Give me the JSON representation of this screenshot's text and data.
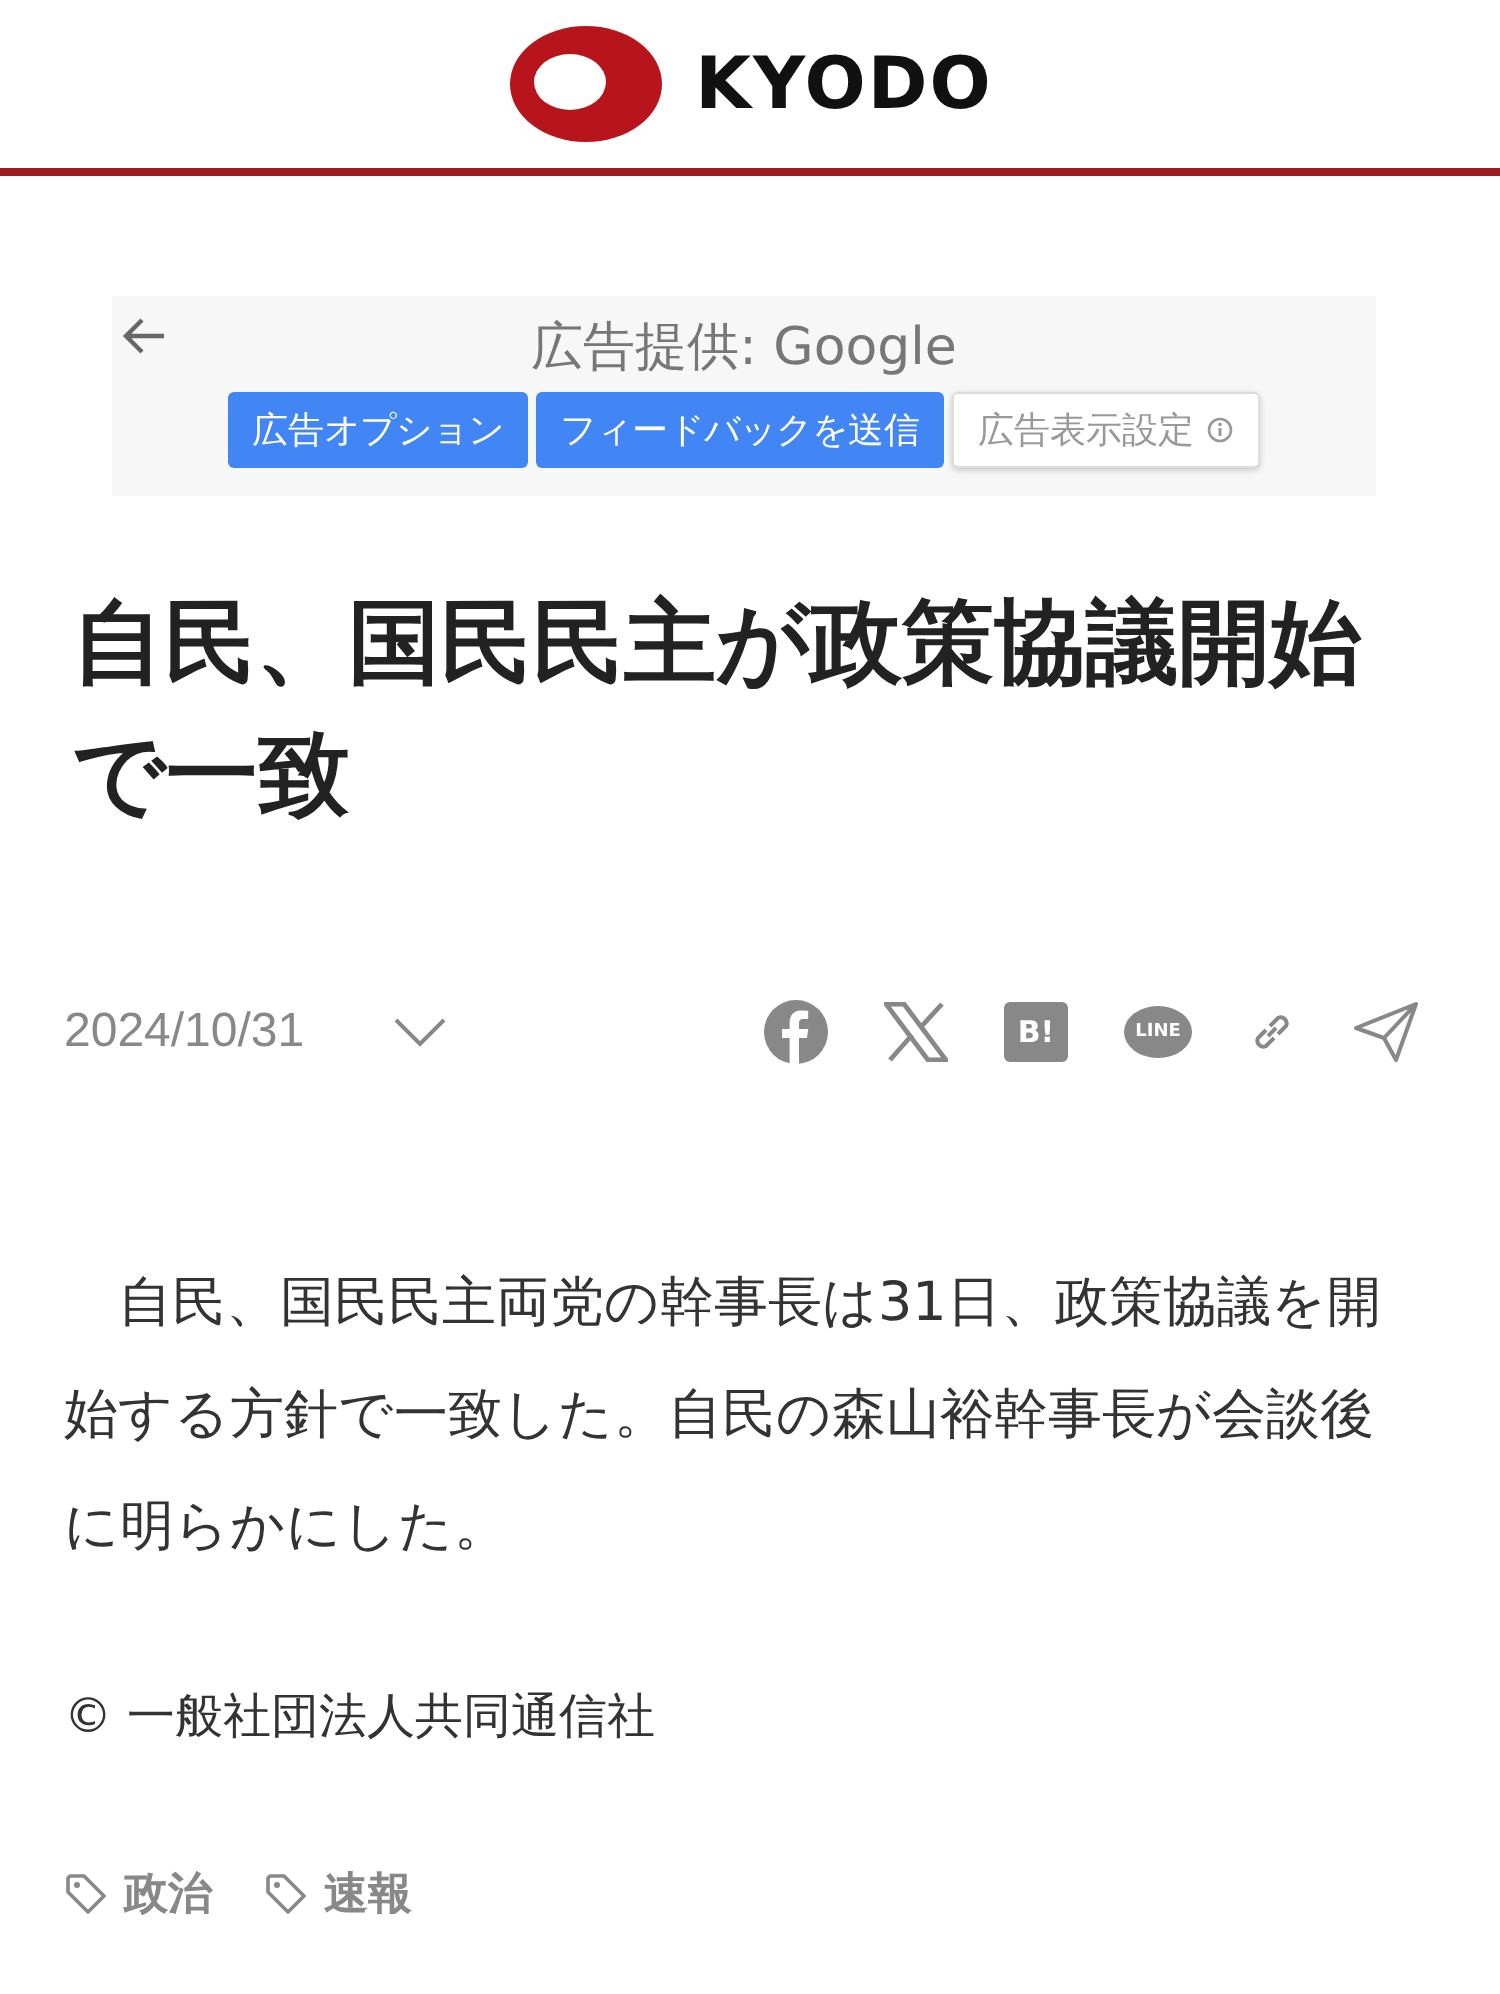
{
  "header": {
    "logo_text": "KYODO"
  },
  "ad": {
    "provider": "広告提供: Google",
    "buttons": [
      {
        "label": "広告オプション",
        "kind": "primary"
      },
      {
        "label": "フィードバックを送信",
        "kind": "primary"
      },
      {
        "label": "広告表示設定",
        "kind": "outline"
      }
    ]
  },
  "article": {
    "title": "自民、国民民主が政策協議開始で一致",
    "date": "2024/10/31",
    "share": [
      {
        "kind": "facebook"
      },
      {
        "kind": "x"
      },
      {
        "kind": "hatena",
        "label": "B!"
      },
      {
        "kind": "line",
        "label": "LINE"
      },
      {
        "kind": "link"
      },
      {
        "kind": "send"
      }
    ],
    "body": "自民、国民民主両党の幹事長は31日、政策協議を開始する方針で一致した。自民の森山裕幹事長が会談後に明らかにした。",
    "copyright": "© 一般社団法人共同通信社",
    "tags": [
      "政治",
      "速報"
    ]
  }
}
